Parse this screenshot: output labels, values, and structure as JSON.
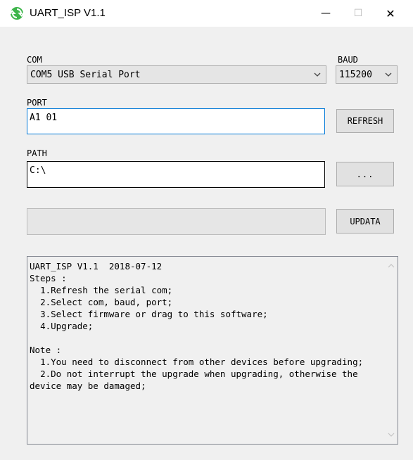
{
  "window": {
    "title": "UART_ISP V1.1",
    "icons": {
      "app": "refresh-arrows-icon",
      "minimize": "minimize-icon",
      "maximize": "maximize-icon",
      "close": "close-icon"
    },
    "minimize_glyph": "—",
    "maximize_glyph": "☐",
    "close_glyph": "✕"
  },
  "com": {
    "label": "COM",
    "selected": "COM5 USB Serial Port"
  },
  "baud": {
    "label": "BAUD",
    "selected": "115200"
  },
  "port": {
    "label": "PORT",
    "value": "A1 01"
  },
  "refresh_button": {
    "label": "REFRESH"
  },
  "path": {
    "label": "PATH",
    "value": "C:\\"
  },
  "browse_button": {
    "label": "..."
  },
  "progress": {
    "value": 0
  },
  "update_button": {
    "label": "UPDATA"
  },
  "info": {
    "text": "UART_ISP V1.1  2018-07-12\nSteps :\n  1.Refresh the serial com;\n  2.Select com, baud, port;\n  3.Select firmware or drag to this software;\n  4.Upgrade;\n\nNote :\n  1.You need to disconnect from other devices before upgrading;\n  2.Do not interrupt the upgrade when upgrading, otherwise the device may be damaged;"
  },
  "colors": {
    "accent_border": "#0078d7",
    "app_icon_green": "#3db54a"
  }
}
